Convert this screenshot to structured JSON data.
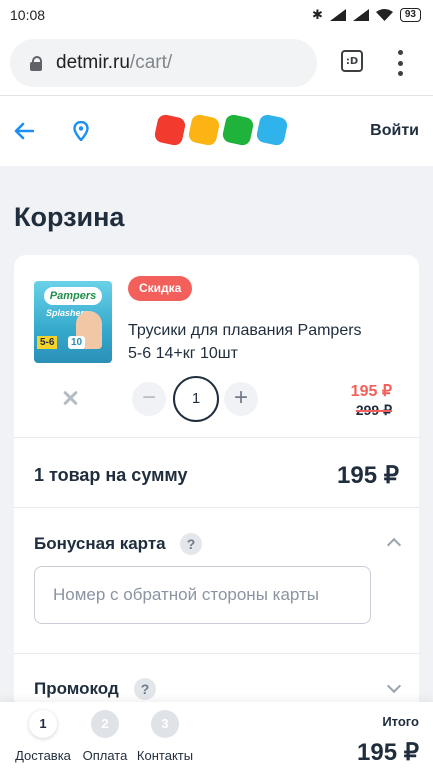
{
  "status_bar": {
    "time": "10:08",
    "battery": "93"
  },
  "browser": {
    "host": "detmir.ru",
    "path": "/cart/",
    "tabs_label": ":D"
  },
  "header": {
    "login_label": "Войти",
    "logo_colors": [
      "#f23a2e",
      "#fbb414",
      "#1fb33b",
      "#2fb3ea"
    ]
  },
  "page": {
    "title": "Корзина"
  },
  "cart_item": {
    "badge": "Скидка",
    "name": "Трусики для плавания Pampers 5-6 14+кг 10шт",
    "image": {
      "brand": "Pampers",
      "sub": "Splashers",
      "size": "5-6",
      "count": "10"
    },
    "quantity": "1",
    "minus_label": "−",
    "plus_label": "+",
    "price_new": "195 ₽",
    "price_old": "299 ₽"
  },
  "summary": {
    "label": "1 товар на сумму",
    "value": "195 ₽"
  },
  "bonus_card": {
    "title": "Бонусная карта",
    "help": "?",
    "input_value": "",
    "placeholder": "Номер с обратной стороны карты"
  },
  "promo": {
    "title": "Промокод",
    "help": "?"
  },
  "checkout_steps": [
    {
      "num": "1",
      "label": "Доставка"
    },
    {
      "num": "2",
      "label": "Оплата"
    },
    {
      "num": "3",
      "label": "Контакты"
    }
  ],
  "total": {
    "label": "Итого",
    "value": "195 ₽"
  },
  "colors": {
    "accent_red": "#f3605b",
    "text_dark": "#1f2d3d",
    "link_blue": "#1d8ff4",
    "page_bg": "#f0f2f5"
  }
}
